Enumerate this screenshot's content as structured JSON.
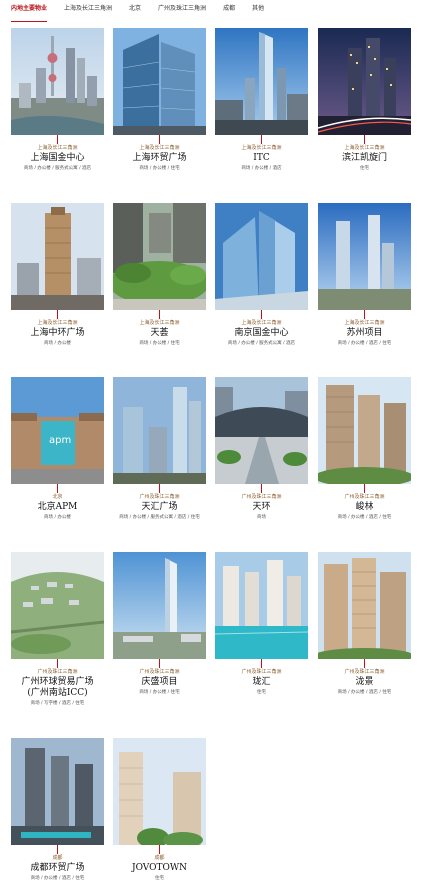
{
  "tabs": [
    {
      "label": "内地主要物业",
      "active": true
    },
    {
      "label": "上海及长江三角洲",
      "active": false
    },
    {
      "label": "北京",
      "active": false
    },
    {
      "label": "广州及珠江三角洲",
      "active": false
    },
    {
      "label": "成都",
      "active": false
    },
    {
      "label": "其他",
      "active": false
    }
  ],
  "colors": {
    "accent": "#b8141b",
    "region": "#8a5a2b"
  },
  "properties": [
    {
      "region": "上海及长江三角洲",
      "name": "上海国金中心",
      "types": "商场 / 办公楼 / 服务式公寓 / 酒店"
    },
    {
      "region": "上海及长江三角洲",
      "name": "上海环贸广场",
      "types": "商场 / 办公楼 / 住宅"
    },
    {
      "region": "上海及长江三角洲",
      "name": "ITC",
      "types": "商场 / 办公楼 / 酒店"
    },
    {
      "region": "上海及长江三角洲",
      "name": "滨江凯旋门",
      "types": "住宅"
    },
    {
      "region": "上海及长江三角洲",
      "name": "上海中环广场",
      "types": "商场 / 办公楼"
    },
    {
      "region": "上海及长江三角洲",
      "name": "天荟",
      "types": "商场 / 办公楼 / 住宅"
    },
    {
      "region": "上海及长江三角洲",
      "name": "南京国金中心",
      "types": "商场 / 办公楼 / 服务式公寓 / 酒店"
    },
    {
      "region": "上海及长江三角洲",
      "name": "苏州项目",
      "types": "商场 / 办公楼 / 酒店 / 住宅"
    },
    {
      "region": "北京",
      "name": "北京APM",
      "types": "商场 / 办公楼"
    },
    {
      "region": "广州及珠江三角洲",
      "name": "天汇广场",
      "types": "商场 / 办公楼 / 服务式公寓 / 酒店 / 住宅"
    },
    {
      "region": "广州及珠江三角洲",
      "name": "天环",
      "types": "商场"
    },
    {
      "region": "广州及珠江三角洲",
      "name": "峻林",
      "types": "商场 / 办公楼 / 酒店 / 住宅"
    },
    {
      "region": "广州及珠江三角洲",
      "name": "广州环球贸易广场",
      "name2": "(广州南站ICC)",
      "types": "商场 / 写字楼 / 酒店 / 住宅"
    },
    {
      "region": "广州及珠江三角洲",
      "name": "庆盛项目",
      "types": "商场 / 办公楼 / 住宅"
    },
    {
      "region": "广州及珠江三角洲",
      "name": "珑汇",
      "types": "住宅"
    },
    {
      "region": "广州及珠江三角洲",
      "name": "泷景",
      "types": "商场 / 办公楼 / 酒店 / 住宅"
    },
    {
      "region": "成都",
      "name": "成都环贸广场",
      "types": "商场 / 办公楼 / 酒店 / 住宅"
    },
    {
      "region": "成都",
      "name": "JOVOTOWN",
      "types": "住宅"
    }
  ]
}
